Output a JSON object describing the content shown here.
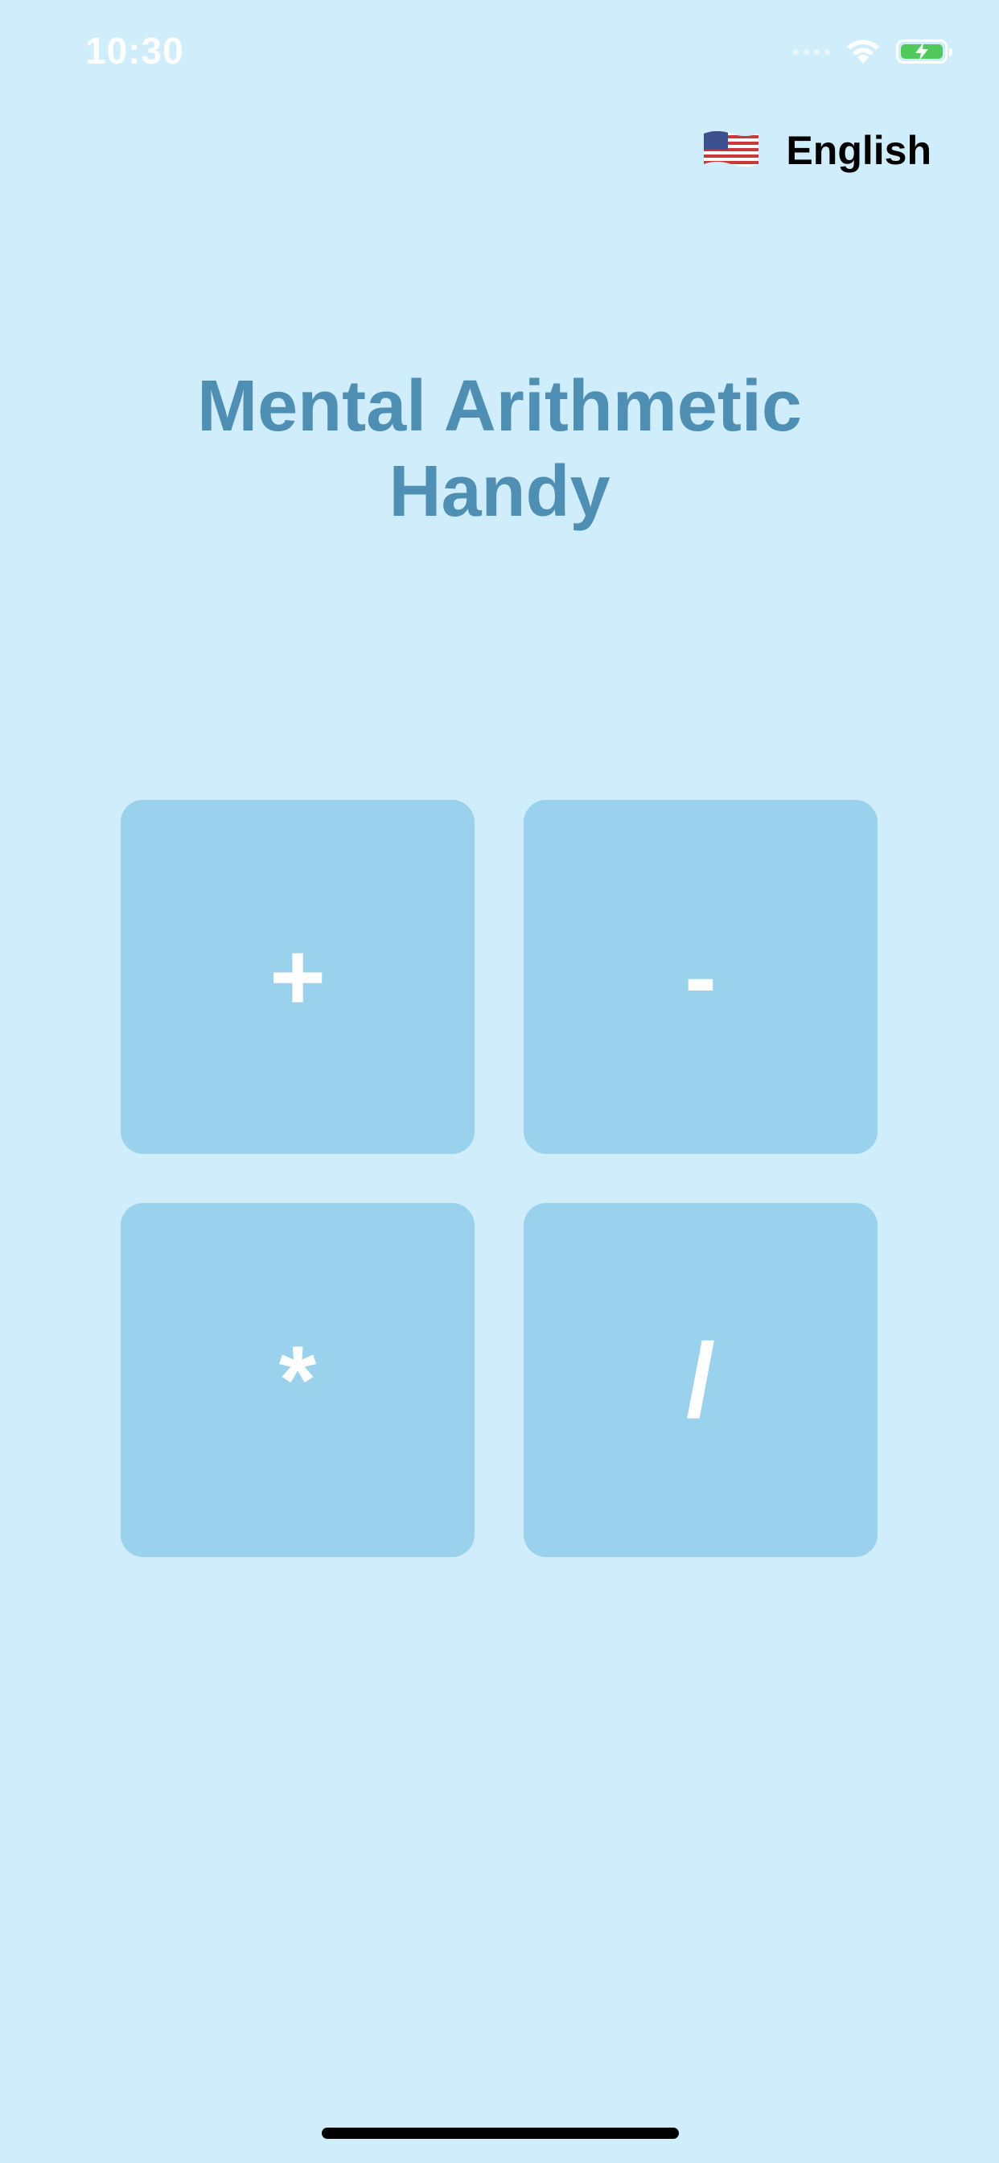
{
  "status_bar": {
    "time": "10:30",
    "battery_level": 1.0,
    "battery_color": "#52c95b",
    "icons": [
      "wifi-icon",
      "battery-charging-icon"
    ]
  },
  "language": {
    "flag_icon": "us-flag-icon",
    "label": "English"
  },
  "title": {
    "line1": "Mental Arithmetic",
    "line2": "Handy"
  },
  "operations": [
    {
      "symbol": "+"
    },
    {
      "symbol": "-"
    },
    {
      "symbol": "*"
    },
    {
      "symbol": "/"
    }
  ],
  "colors": {
    "background": "#cfedfa",
    "title": "#4f8fb3",
    "button": "#9ad1ec",
    "button_text": "#ffffff"
  }
}
